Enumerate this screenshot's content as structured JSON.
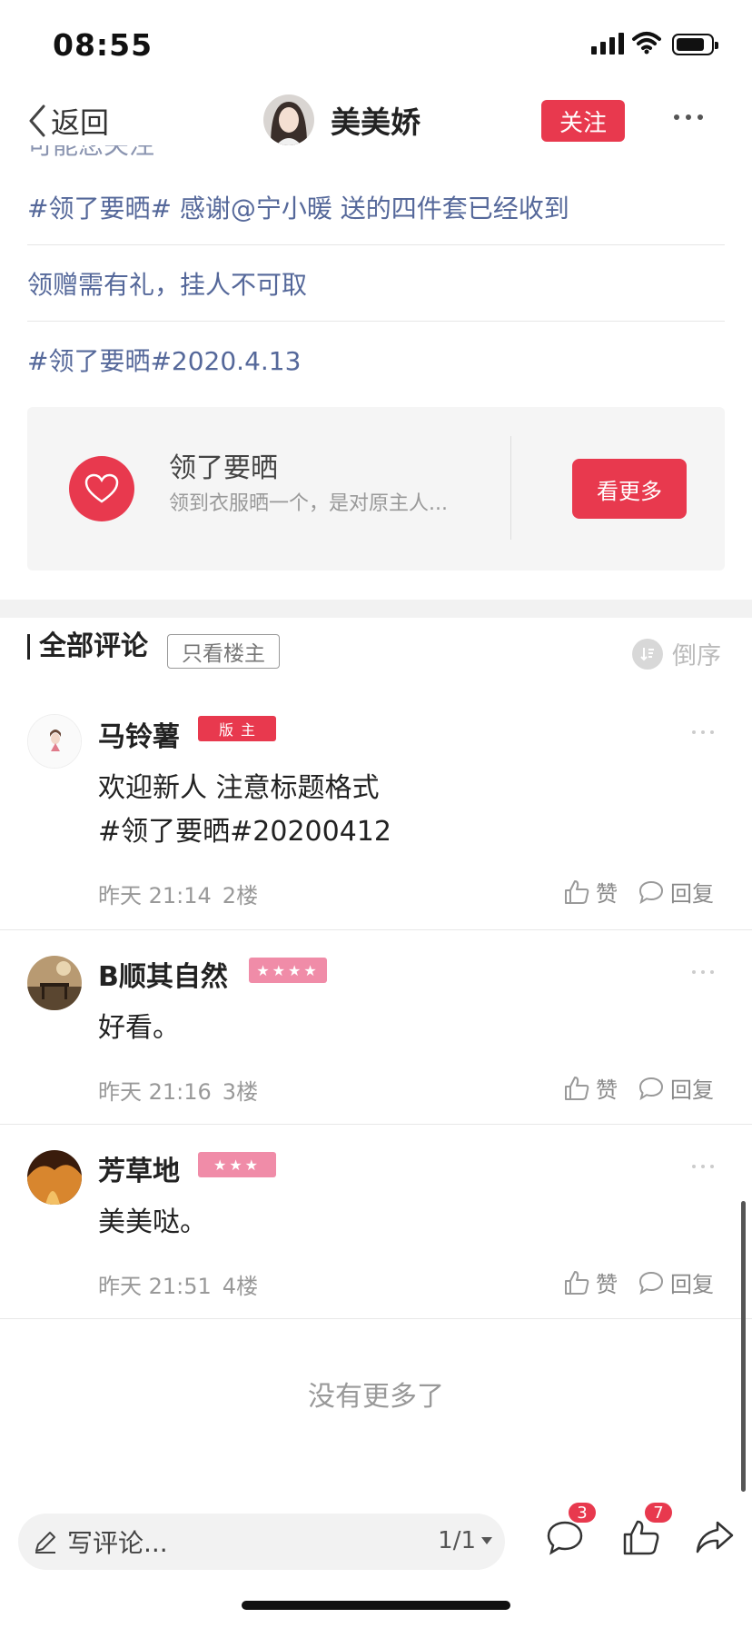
{
  "status_bar": {
    "time": "08:55"
  },
  "nav": {
    "back_label": "返回",
    "username": "美美娇",
    "follow_label": "关注"
  },
  "post": {
    "cut_text": "可能您关注的",
    "lines": [
      "#领了要晒# 感谢@宁小暖 送的四件套已经收到",
      "领赠需有礼，挂人不可取",
      "#领了要晒#2020.4.13"
    ]
  },
  "topic_card": {
    "title": "领了要晒",
    "description": "领到衣服晒一个，是对原主人...",
    "button_label": "看更多"
  },
  "comments_header": {
    "title": "全部评论",
    "op_only_label": "只看楼主",
    "sort_label": "倒序"
  },
  "comments": [
    {
      "name": "马铃薯",
      "badge": "版主",
      "text_lines": [
        "欢迎新人 注意标题格式",
        "#领了要晒#20200412"
      ],
      "time": "昨天 21:14",
      "floor": "2楼",
      "like_label": "赞",
      "reply_label": "回复"
    },
    {
      "name": "B顺其自然",
      "badge": "★★★★",
      "text_lines": [
        "好看。"
      ],
      "time": "昨天 21:16",
      "floor": "3楼",
      "like_label": "赞",
      "reply_label": "回复"
    },
    {
      "name": "芳草地",
      "badge": "★★★",
      "text_lines": [
        "美美哒。"
      ],
      "time": "昨天 21:51",
      "floor": "4楼",
      "like_label": "赞",
      "reply_label": "回复"
    }
  ],
  "footer": {
    "no_more_label": "没有更多了"
  },
  "bottom_bar": {
    "input_placeholder": "写评论...",
    "page_indicator": "1/1",
    "comment_count": "3",
    "like_count": "7"
  },
  "colors": {
    "accent": "#e8394e",
    "link": "#55689a",
    "star_badge": "#f08ca8"
  }
}
